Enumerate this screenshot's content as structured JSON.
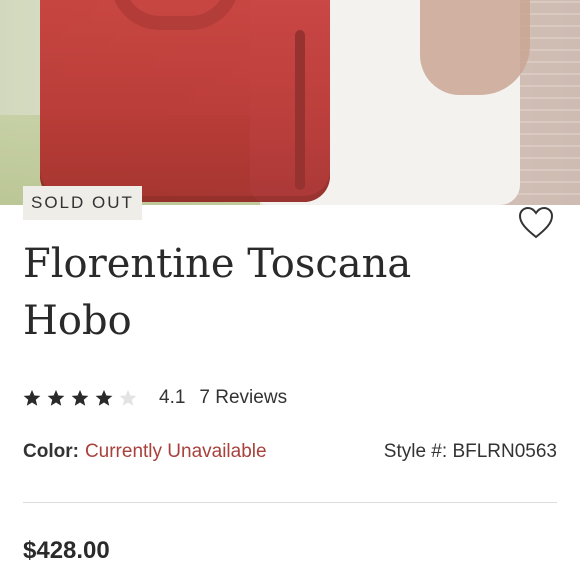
{
  "product": {
    "badge": "SOLD OUT",
    "title_line1": "Florentine Toscana",
    "title_line2": "Hobo",
    "rating": {
      "stars_filled": 4,
      "stars_total": 5,
      "value": "4.1",
      "reviews": "7 Reviews"
    },
    "color": {
      "label": "Color:",
      "value": "Currently Unavailable",
      "value_color": "#a8413c"
    },
    "style": {
      "label": "Style #:",
      "value": "BFLRN0563"
    },
    "price": "$428.00"
  },
  "icons": {
    "favorite": "heart-outline-icon",
    "star_filled": "star-filled-icon",
    "star_empty": "star-empty-icon"
  }
}
